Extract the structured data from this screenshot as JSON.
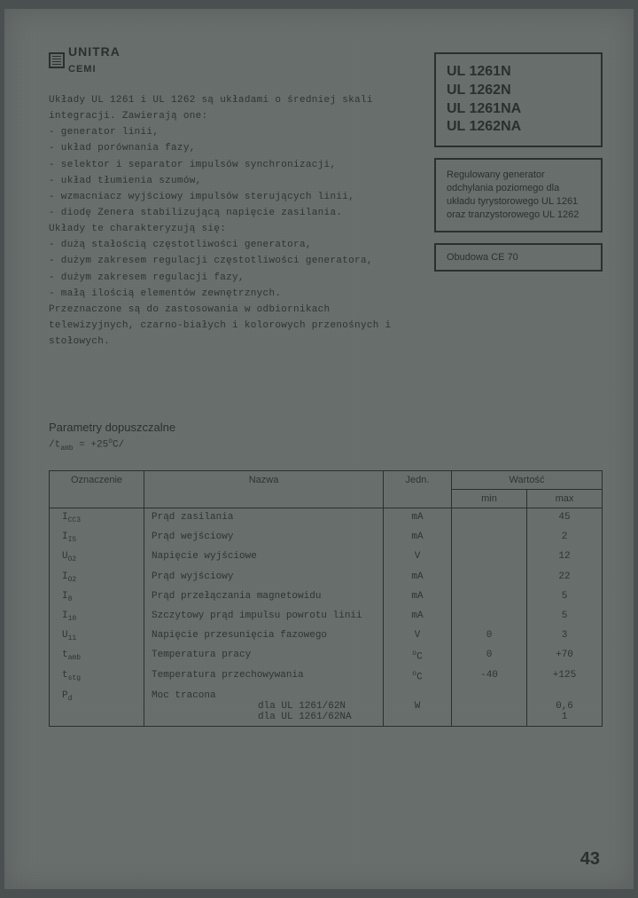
{
  "logo": {
    "brand": "UNITRA",
    "sub": "CEMI"
  },
  "intro": {
    "lead": "Układy UL 1261 i UL 1262 są układami o średniej skali integracji. Zawierają one:",
    "bullets1": [
      "- generator linii,",
      "- układ porównania fazy,",
      "- selektor i separator impulsów synchronizacji,",
      "- układ tłumienia szumów,",
      "- wzmacniacz wyjściowy impulsów sterujących linii,",
      "- diodę Zenera stabilizującą napięcie zasilania."
    ],
    "lead2": "Układy te charakteryzują się:",
    "bullets2": [
      "- dużą stałością częstotliwości generatora,",
      "- dużym zakresem regulacji częstotliwości generatora,",
      "- dużym zakresem regulacji fazy,",
      "- małą ilością elementów zewnętrznych."
    ],
    "tail": "Przeznaczone są do zastosowania w odbiornikach telewizyjnych, czarno-białych i kolorowych przenośnych i stołowych."
  },
  "parts": [
    "UL 1261N",
    "UL 1262N",
    "UL 1261NA",
    "UL 1262NA"
  ],
  "desc": "Regulowany generator odchylania poziomego dla układu tyrystorowego UL 1261 oraz tranzystorowego UL 1262",
  "pkg": "Obudowa CE 70",
  "section": {
    "title": "Parametry dopuszczalne",
    "cond": "/t_amb = +25°C/"
  },
  "table": {
    "headers": {
      "sym": "Oznaczenie",
      "name": "Nazwa",
      "unit": "Jedn.",
      "val": "Wartość",
      "min": "min",
      "max": "max"
    },
    "rows": [
      {
        "sym": "I_CC3",
        "name": "Prąd zasilania",
        "unit": "mA",
        "min": "",
        "max": "45"
      },
      {
        "sym": "I_I5",
        "name": "Prąd wejściowy",
        "unit": "mA",
        "min": "",
        "max": "2"
      },
      {
        "sym": "U_O2",
        "name": "Napięcie wyjściowe",
        "unit": "V",
        "min": "",
        "max": "12"
      },
      {
        "sym": "I_O2",
        "name": "Prąd wyjściowy",
        "unit": "mA",
        "min": "",
        "max": "22"
      },
      {
        "sym": "I_8",
        "name": "Prąd przełączania magnetowidu",
        "unit": "mA",
        "min": "",
        "max": "5"
      },
      {
        "sym": "I_10",
        "name": "Szczytowy prąd impulsu powrotu linii",
        "unit": "mA",
        "min": "",
        "max": "5"
      },
      {
        "sym": "U_11",
        "name": "Napięcie przesunięcia fazowego",
        "unit": "V",
        "min": "0",
        "max": "3"
      },
      {
        "sym": "t_amb",
        "name": "Temperatura pracy",
        "unit": "°C",
        "min": "0",
        "max": "+70"
      },
      {
        "sym": "t_stg",
        "name": "Temperatura przechowywania",
        "unit": "°C",
        "min": "-40",
        "max": "+125"
      },
      {
        "sym": "P_d",
        "name": "Moc tracona",
        "sub1": "dla UL 1261/62N",
        "sub2": "dla UL 1261/62NA",
        "unit": "W",
        "max1": "0,6",
        "max2": "1"
      }
    ]
  },
  "page_num": "43"
}
